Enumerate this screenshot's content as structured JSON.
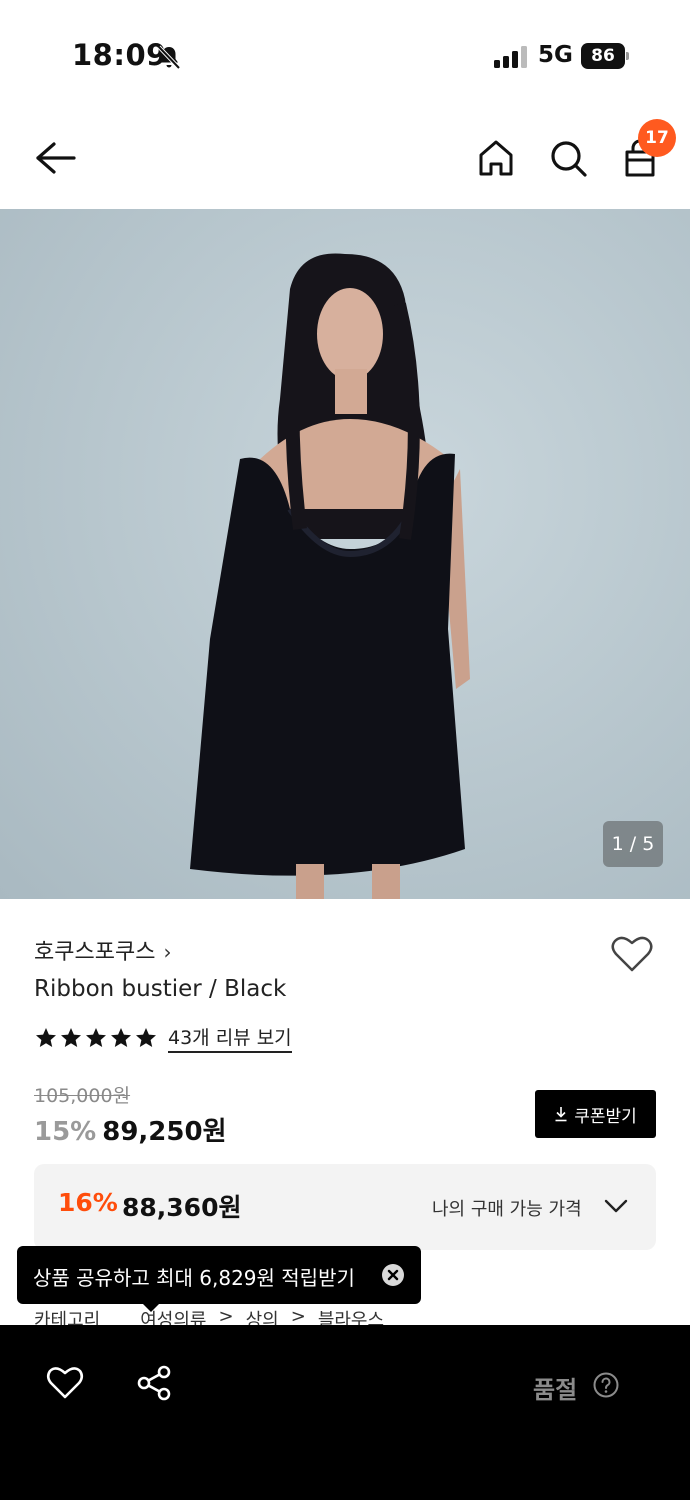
{
  "status_bar": {
    "time": "18:09",
    "network": "5G",
    "battery": "86"
  },
  "header": {
    "back_icon": "arrow-left-icon",
    "home_icon": "home-icon",
    "search_icon": "search-icon",
    "cart_icon": "shopping-bag-icon",
    "cart_count": "17"
  },
  "gallery": {
    "page_indicator": "1 / 5",
    "current": 1,
    "total": 5
  },
  "product": {
    "brand": "호쿠스포쿠스",
    "brand_chevron": "›",
    "name": "Ribbon bustier / Black",
    "rating_stars": 5,
    "review_link": "43개 리뷰 보기",
    "original_price": "105,000원",
    "discount_rate": "15%",
    "sale_price": "89,250원",
    "coupon_button": "쿠폰받기"
  },
  "member_price": {
    "rate": "16%",
    "price": "88,360원",
    "label": "나의 구매 가능 가격"
  },
  "tooltip": {
    "text": "상품 공유하고 최대 6,829원 적립받기"
  },
  "category": {
    "label": "카테고리",
    "path": [
      "여성의류",
      "상의",
      "블라우스"
    ],
    "separator": ">"
  },
  "bottom_bar": {
    "status_label": "품절",
    "help_icon": "question-circle-icon"
  },
  "colors": {
    "accent": "#ff5a1f",
    "member_rate": "#ff4d0b",
    "bottom_bar": "#000000"
  }
}
